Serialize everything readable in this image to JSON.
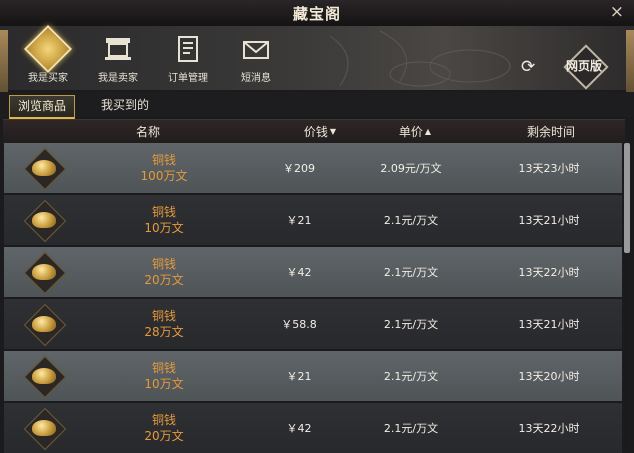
{
  "window": {
    "title": "藏宝阁",
    "close_label": "×"
  },
  "nav": {
    "items": [
      {
        "label": "我是买家",
        "icon": "buyer-coin-icon",
        "active": true
      },
      {
        "label": "我是卖家",
        "icon": "shop-stall-icon",
        "active": false
      },
      {
        "label": "订单管理",
        "icon": "order-book-icon",
        "active": false
      },
      {
        "label": "短消息",
        "icon": "envelope-icon",
        "active": false
      }
    ],
    "refresh_icon": "refresh-icon",
    "web_version_label": "网页版"
  },
  "tabs": [
    {
      "label": "浏览商品",
      "active": true
    },
    {
      "label": "我买到的",
      "active": false
    }
  ],
  "table": {
    "headers": {
      "name": "名称",
      "price": "价钱",
      "unit_price": "单价",
      "remaining": "剩余时间"
    },
    "rows": [
      {
        "name": "铜钱",
        "amount": "100万文",
        "price": "￥209",
        "unit_price": "2.09元/万文",
        "remaining": "13天23小时"
      },
      {
        "name": "铜钱",
        "amount": "10万文",
        "price": "￥21",
        "unit_price": "2.1元/万文",
        "remaining": "13天21小时"
      },
      {
        "name": "铜钱",
        "amount": "20万文",
        "price": "￥42",
        "unit_price": "2.1元/万文",
        "remaining": "13天22小时"
      },
      {
        "name": "铜钱",
        "amount": "28万文",
        "price": "￥58.8",
        "unit_price": "2.1元/万文",
        "remaining": "13天21小时"
      },
      {
        "name": "铜钱",
        "amount": "10万文",
        "price": "￥21",
        "unit_price": "2.1元/万文",
        "remaining": "13天20小时"
      },
      {
        "name": "铜钱",
        "amount": "20万文",
        "price": "￥42",
        "unit_price": "2.1元/万文",
        "remaining": "13天22小时"
      }
    ]
  },
  "colors": {
    "item_name": "#e59a3c",
    "tab_accent": "#e2b84a",
    "row_alt": "#5f6568",
    "row_plain": "#2f3033"
  }
}
